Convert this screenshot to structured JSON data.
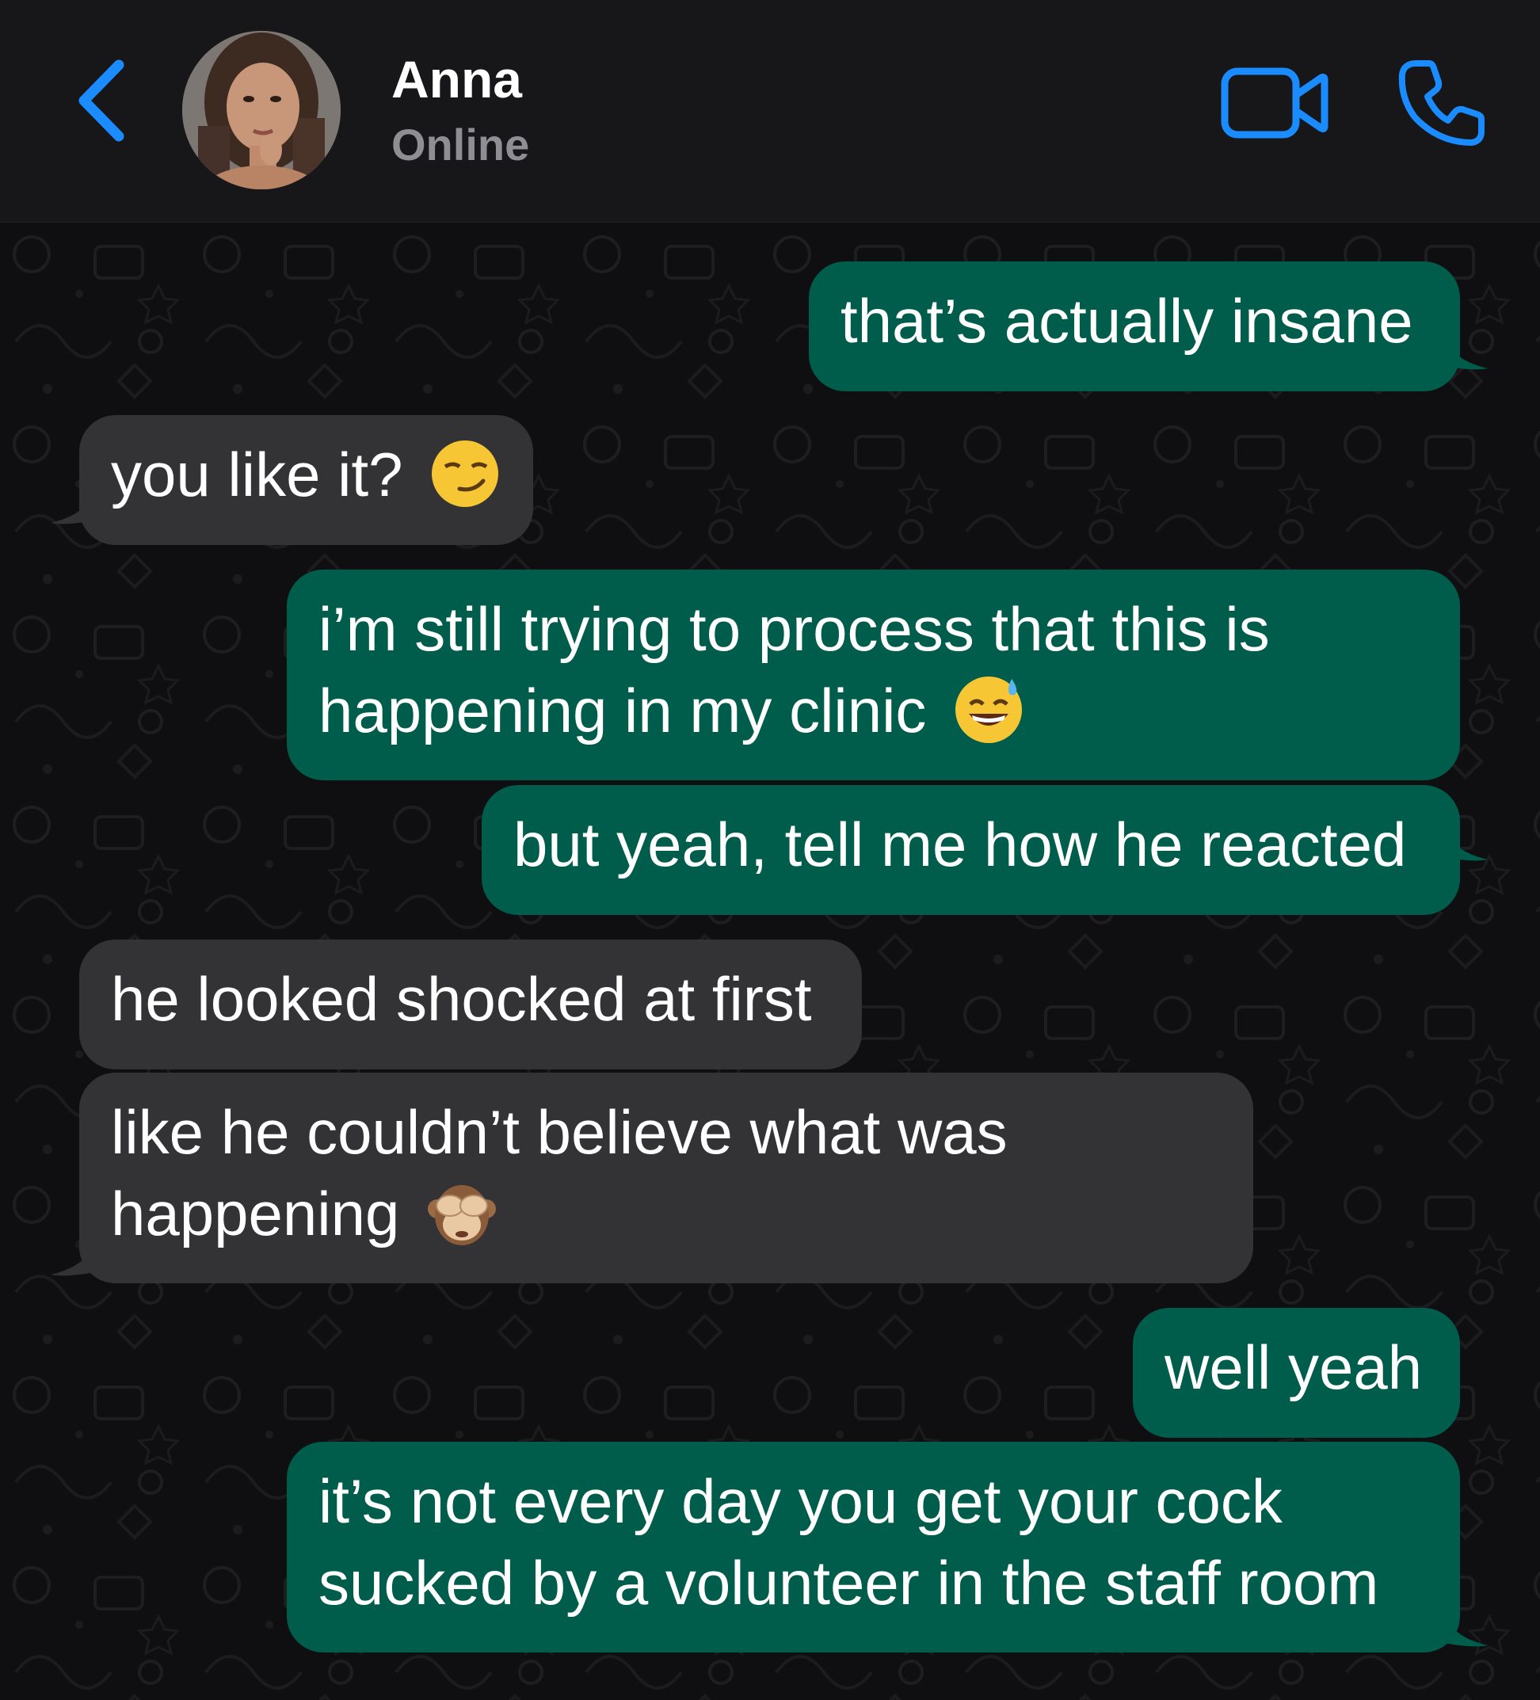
{
  "header": {
    "contact_name": "Anna",
    "contact_status": "Online",
    "back_icon": "chevron-left-icon",
    "video_icon": "video-camera-icon",
    "call_icon": "phone-icon"
  },
  "colors": {
    "accent": "#1a8cff",
    "outgoing_bubble": "#005c4b",
    "incoming_bubble": "#333335",
    "header_bg": "#171719"
  },
  "messages": [
    {
      "direction": "out",
      "text": "that’s actually insane"
    },
    {
      "direction": "in",
      "text": "you like it?",
      "emoji": "smirking-face"
    },
    {
      "direction": "out",
      "line1": "i’m still trying to process that this is",
      "line2": "happening in my clinic",
      "emoji": "grinning-face-with-sweat"
    },
    {
      "direction": "out",
      "text": "but yeah, tell me how he reacted"
    },
    {
      "direction": "in",
      "text": "he looked shocked at first"
    },
    {
      "direction": "in",
      "line1": "like he couldn’t believe what was",
      "line2": "happening",
      "emoji": "see-no-evil-monkey"
    },
    {
      "direction": "out",
      "text": "well yeah"
    },
    {
      "direction": "out",
      "line1": "it’s not every day you get your cock",
      "line2": "sucked by a volunteer in the staff room"
    }
  ]
}
